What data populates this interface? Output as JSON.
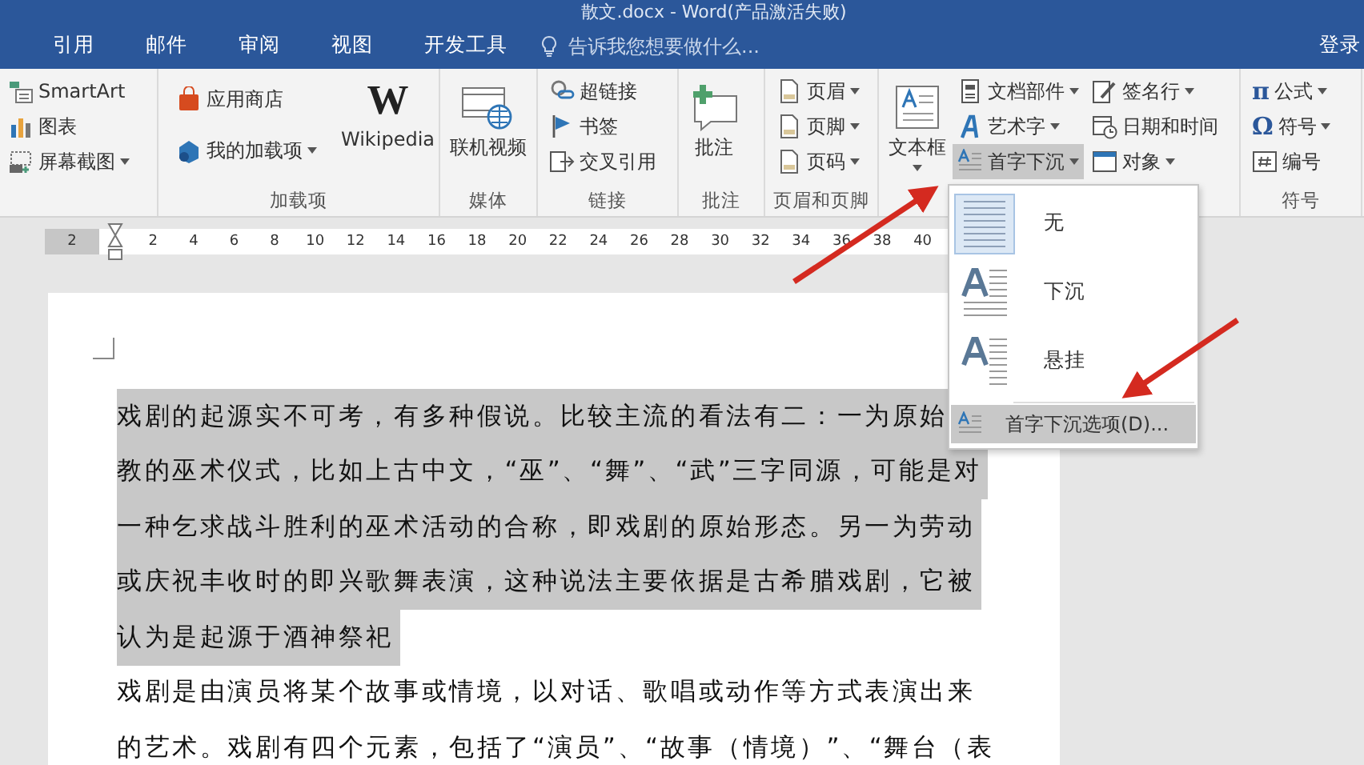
{
  "window": {
    "title": "散文.docx - Word(产品激活失败)"
  },
  "tabs": [
    {
      "label": "引用",
      "selected": false
    },
    {
      "label": "邮件",
      "selected": false
    },
    {
      "label": "审阅",
      "selected": false
    },
    {
      "label": "视图",
      "selected": false
    },
    {
      "label": "开发工具",
      "selected": false
    }
  ],
  "search": {
    "placeholder": "告诉我您想要做什么..."
  },
  "login": "登录",
  "ribbon": {
    "groups": [
      {
        "columns": [
          {
            "kind": "stack",
            "items": [
              {
                "label": "SmartArt"
              },
              {
                "label": "图表"
              },
              {
                "label": "屏幕截图",
                "dropdown": true
              }
            ]
          }
        ]
      },
      {
        "label": "加载项",
        "columns": [
          {
            "kind": "stack",
            "items": [
              {
                "label": "应用商店"
              },
              {
                "label": "我的加载项",
                "dropdown": true
              }
            ]
          },
          {
            "kind": "large",
            "items": [
              {
                "label": "Wikipedia",
                "glyph": "W"
              }
            ]
          }
        ]
      },
      {
        "label": "媒体",
        "columns": [
          {
            "kind": "large",
            "items": [
              {
                "label": "联机视频"
              }
            ]
          }
        ]
      },
      {
        "label": "链接",
        "columns": [
          {
            "kind": "stack",
            "items": [
              {
                "label": "超链接"
              },
              {
                "label": "书签"
              },
              {
                "label": "交叉引用"
              }
            ]
          }
        ]
      },
      {
        "label": "批注",
        "columns": [
          {
            "kind": "large",
            "items": [
              {
                "label": "批注"
              }
            ]
          }
        ]
      },
      {
        "label": "页眉和页脚",
        "columns": [
          {
            "kind": "stack",
            "items": [
              {
                "label": "页眉",
                "dropdown": true
              },
              {
                "label": "页脚",
                "dropdown": true
              },
              {
                "label": "页码",
                "dropdown": true
              }
            ]
          }
        ]
      },
      {
        "columns": [
          {
            "kind": "large",
            "items": [
              {
                "label": "文本框",
                "dropdown": true
              }
            ]
          },
          {
            "kind": "stack",
            "items": [
              {
                "label": "文档部件",
                "dropdown": true
              },
              {
                "label": "艺术字",
                "dropdown": true
              },
              {
                "label": "首字下沉",
                "dropdown": true,
                "expanded": true
              }
            ]
          },
          {
            "kind": "stack",
            "items": [
              {
                "label": "签名行",
                "dropdown": true
              },
              {
                "label": "日期和时间"
              },
              {
                "label": "对象",
                "dropdown": true
              }
            ]
          }
        ]
      },
      {
        "label": "符号",
        "columns": [
          {
            "kind": "stack",
            "items": [
              {
                "label": "公式",
                "dropdown": true,
                "glyph": "π"
              },
              {
                "label": "符号",
                "dropdown": true,
                "glyph": "Ω"
              },
              {
                "label": "编号"
              }
            ]
          }
        ]
      }
    ]
  },
  "ruler": {
    "labels": [
      "2",
      "2",
      "4",
      "6",
      "8",
      "10",
      "12",
      "14",
      "16",
      "18",
      "20",
      "22",
      "24",
      "26",
      "28",
      "30",
      "32",
      "34",
      "36",
      "38",
      "40"
    ]
  },
  "document": {
    "paragraphs": [
      {
        "selected": true,
        "lines": [
          "戏剧的起源实不可考，有多种假说。比较主流的看法有二：一为原始",
          "教的巫术仪式，比如上古中文，“巫”、“舞”、“武”三字同源，可能是对",
          "一种乞求战斗胜利的巫术活动的合称，即戏剧的原始形态。另一为劳动",
          "或庆祝丰收时的即兴歌舞表演，这种说法主要依据是古希腊戏剧，它被",
          "认为是起源于酒神祭祀"
        ]
      },
      {
        "selected": false,
        "lines": [
          "戏剧是由演员将某个故事或情境，以对话、歌唱或动作等方式表演出来",
          "的艺术。戏剧有四个元素，包括了“演员”、“故事（情境）”、“舞台（表"
        ]
      }
    ]
  },
  "dropdown_menu": {
    "items": [
      {
        "label": "无",
        "kind": "none",
        "selected": true
      },
      {
        "label": "下沉",
        "kind": "dropped",
        "selected": false
      },
      {
        "label": "悬挂",
        "kind": "margin",
        "selected": false
      }
    ],
    "option": {
      "label": "首字下沉选项(D)...",
      "hovered": true
    }
  }
}
